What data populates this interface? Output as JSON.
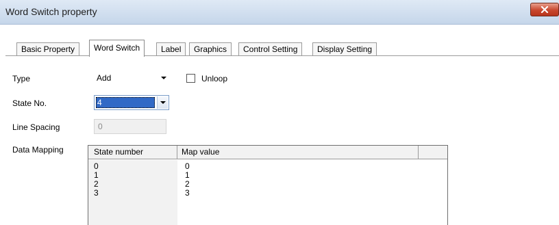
{
  "window": {
    "title": "Word Switch property"
  },
  "tabs": [
    {
      "label": "Basic Property",
      "active": false
    },
    {
      "label": "Word Switch",
      "active": true
    },
    {
      "label": "Label",
      "active": false
    },
    {
      "label": "Graphics",
      "active": false
    },
    {
      "label": "Control Setting",
      "active": false
    },
    {
      "label": "Display Setting",
      "active": false
    }
  ],
  "form": {
    "type_label": "Type",
    "type_value": "Add",
    "unloop_label": "Unloop",
    "unloop_checked": false,
    "state_no_label": "State No.",
    "state_no_value": "4",
    "line_spacing_label": "Line Spacing",
    "line_spacing_value": "0",
    "data_mapping_label": "Data Mapping"
  },
  "mapping_table": {
    "headers": [
      "State number",
      "Map value"
    ],
    "rows": [
      [
        "0",
        "0"
      ],
      [
        "1",
        "1"
      ],
      [
        "2",
        "2"
      ],
      [
        "3",
        "3"
      ]
    ]
  },
  "colors": {
    "selection": "#3169c6",
    "close_button": "#c8472e"
  }
}
